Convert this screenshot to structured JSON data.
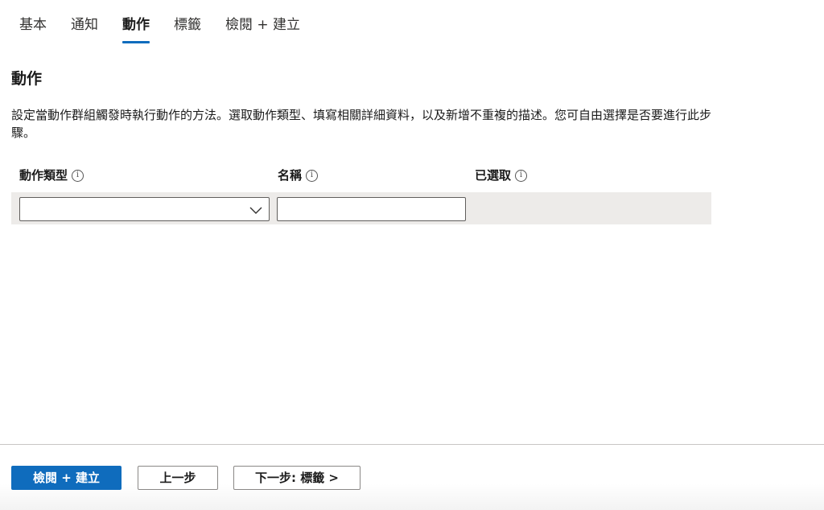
{
  "tabs": [
    {
      "label": "基本",
      "active": false
    },
    {
      "label": "通知",
      "active": false
    },
    {
      "label": "動作",
      "active": true
    },
    {
      "label": "標籤",
      "active": false
    },
    {
      "label": "檢閱 + 建立",
      "active": false
    }
  ],
  "section": {
    "title": "動作",
    "description": "設定當動作群組觸發時執行動作的方法。選取動作類型、填寫相關詳細資料，以及新增不重複的描述。您可自由選擇是否要進行此步驟。"
  },
  "columns": {
    "action_type": "動作類型",
    "name": "名稱",
    "selected": "已選取"
  },
  "row": {
    "action_type_value": "",
    "name_value": ""
  },
  "icons": {
    "info": "info-icon",
    "dropdown": "chevron-down-icon"
  },
  "footer": {
    "review_create": "檢閱 + 建立",
    "previous": "上一步",
    "next": "下一步: 標籤 >"
  },
  "colors": {
    "accent": "#0f6cbd",
    "row_bg": "#edebe9"
  }
}
